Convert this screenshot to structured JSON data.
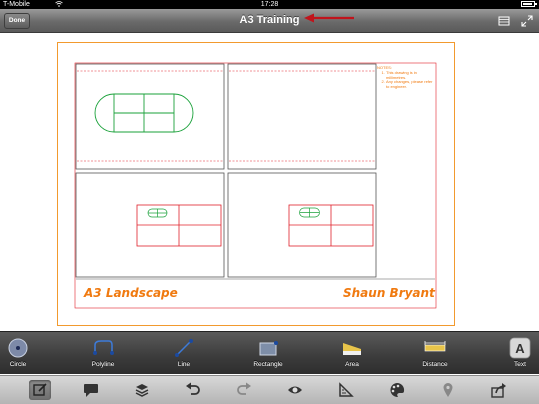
{
  "status_bar": {
    "carrier": "T-Mobile",
    "time": "17:28",
    "battery_icon": "battery-icon",
    "wifi_icon": "wifi-icon"
  },
  "nav_bar": {
    "done_label": "Done",
    "title": "A3 Training",
    "annotation_icon": "red-arrow-icon",
    "right_icons": [
      "layers-panel-icon",
      "expand-icon"
    ]
  },
  "drawing": {
    "title_left": "A3 Landscape",
    "title_right": "Shaun Bryant",
    "notes": {
      "heading": "NOTES:",
      "items": [
        "This drawing is in millimetres.",
        "Any changes, please refer to engineer."
      ]
    },
    "colors": {
      "border": "#f29a2e",
      "title": "#f07a10",
      "viewport": "#555555",
      "red_geometry": "#e0202a",
      "green_geometry": "#1aa13a"
    }
  },
  "draw_toolbar": {
    "tools": [
      {
        "label": "Circle",
        "icon": "circle-tool-icon"
      },
      {
        "label": "Polyline",
        "icon": "polyline-tool-icon"
      },
      {
        "label": "Line",
        "icon": "line-tool-icon"
      },
      {
        "label": "Rectangle",
        "icon": "rectangle-tool-icon"
      },
      {
        "label": "Area",
        "icon": "area-tool-icon"
      },
      {
        "label": "Distance",
        "icon": "distance-tool-icon"
      },
      {
        "label": "Text",
        "icon": "text-tool-icon"
      }
    ]
  },
  "bottom_toolbar": {
    "icons": [
      "draw-mode-icon",
      "comment-icon",
      "layers-icon",
      "undo-icon",
      "redo-icon",
      "view-eye-icon",
      "measure-icon",
      "palette-icon",
      "location-pin-icon",
      "share-icon"
    ],
    "active": "draw-mode-icon"
  }
}
